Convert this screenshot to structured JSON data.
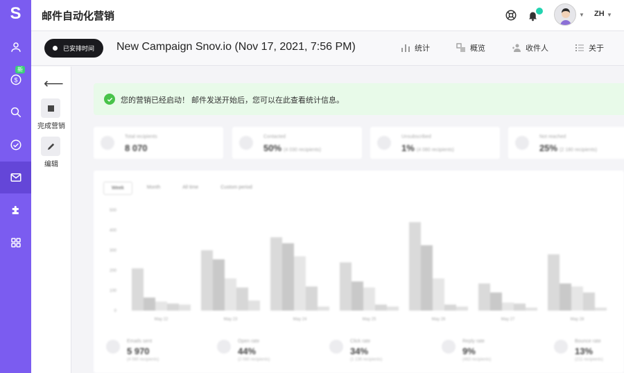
{
  "sidebar": {
    "logo": "S",
    "badge_new": "新",
    "items": [
      {
        "name": "people-icon"
      },
      {
        "name": "coin-icon"
      },
      {
        "name": "search-icon"
      },
      {
        "name": "check-circle-icon"
      },
      {
        "name": "mail-icon",
        "active": true
      },
      {
        "name": "puzzle-icon"
      },
      {
        "name": "apps-grid-icon"
      }
    ]
  },
  "header": {
    "title": "邮件自动化营销",
    "lang": "ZH"
  },
  "campaign": {
    "status": "已安排时间",
    "title": "New Campaign Snov.io (Nov 17, 2021, 7:56 PM)",
    "actions": {
      "stats": "统计",
      "overview": "概览",
      "recipients": "收件人",
      "about": "关于"
    }
  },
  "subnav": {
    "finish_label": "完成营销",
    "edit_label": "编辑"
  },
  "alert": {
    "text": "您的营销已经启动！ 邮件发送开始后，您可以在此查看统计信息。"
  },
  "stat_cards": [
    {
      "label": "Total recipients",
      "value": "8 070",
      "sub": ""
    },
    {
      "label": "Contacted",
      "value": "50%",
      "sub": "(4 030 recipients)"
    },
    {
      "label": "Unsubscribed",
      "value": "1%",
      "sub": "(4 080 recipients)"
    },
    {
      "label": "Not reached",
      "value": "25%",
      "sub": "(2 180 recipients)"
    }
  ],
  "chart_tabs": [
    "Week",
    "Month",
    "All time",
    "Custom period"
  ],
  "chart_data": {
    "type": "bar",
    "categories": [
      "May 22",
      "May 23",
      "May 24",
      "May 25",
      "May 26",
      "May 27",
      "May 28"
    ],
    "series": [
      {
        "values": [
          210,
          300,
          365,
          240,
          440,
          135,
          280
        ]
      },
      {
        "values": [
          65,
          255,
          335,
          145,
          325,
          90,
          135
        ]
      },
      {
        "values": [
          45,
          160,
          270,
          115,
          160,
          40,
          120
        ]
      },
      {
        "values": [
          35,
          115,
          120,
          30,
          30,
          35,
          90
        ]
      },
      {
        "values": [
          30,
          50,
          20,
          20,
          20,
          15,
          15
        ]
      }
    ],
    "yticks": [
      "0",
      "100",
      "200",
      "300",
      "400",
      "500"
    ],
    "ylim": [
      0,
      500
    ],
    "colors": [
      "#dadada",
      "#c9c9c9",
      "#e6e6e6",
      "#d7d7d7",
      "#e2e2e2"
    ]
  },
  "metrics": [
    {
      "label": "Emails sent",
      "value": "5 970",
      "sub": "(4 080 recipients)"
    },
    {
      "label": "Open rate",
      "value": "44%",
      "sub": "(2 080 recipients)"
    },
    {
      "label": "Click rate",
      "value": "34%",
      "sub": "(1 136 recipients)"
    },
    {
      "label": "Reply rate",
      "value": "9%",
      "sub": "(463 recipients)"
    },
    {
      "label": "Bounce rate",
      "value": "13%",
      "sub": "(211 recipients)"
    }
  ]
}
